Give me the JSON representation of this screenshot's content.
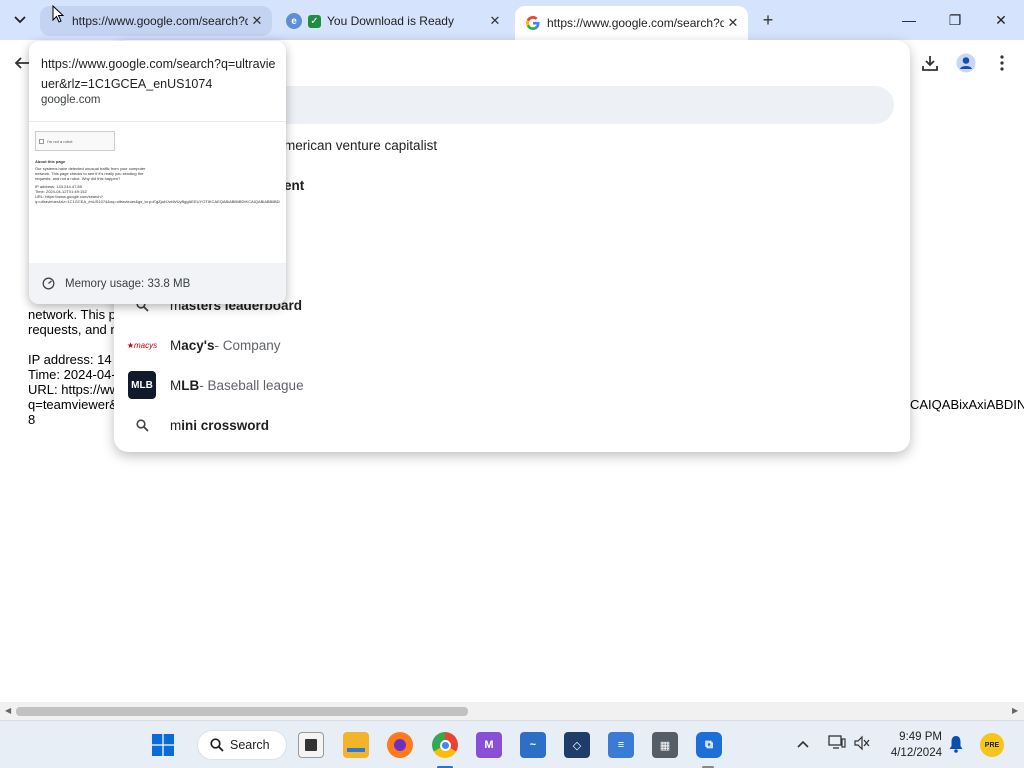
{
  "tabs": [
    {
      "title": "https://www.google.com/search?q=ultravieuer&rlz=1C1GCEA_enUS1074",
      "favicon": "google-g-icon",
      "active": false,
      "hovered": true
    },
    {
      "title": "You Download is Ready",
      "favicon": "checkmark-icon",
      "active": false
    },
    {
      "title": "https://www.google.com/search?q=teamviewer",
      "favicon": "google-g-icon",
      "active": true
    }
  ],
  "window_controls": {
    "minimize": "—",
    "maximize": "❐",
    "close": "✕"
  },
  "hovercard": {
    "url": "https://www.google.com/search?q=ultravieuer&rlz=1C1GCEA_enUS1074",
    "domain": "google.com",
    "memory": "Memory usage: 33.8 MB",
    "thumb_captcha": "I'm not a robot",
    "thumb_heading": "About this page",
    "thumb_lines": [
      "Our systems have detected unusual traffic from your computer",
      "network. This page checks to see if it's really you sending the",
      "requests, and not a robot. Why did this happen?",
      "IP address: 143.244.47.85",
      "Time: 2024-04-12T01:49:15Z",
      "URL: https://www.google.com/search?",
      "q=ultravieuer&rlz=1C1GCEA_enUS1074&oq=ultravieuer&gs_lcrp=EgZjaHJvbWUyBggAEEUYOTIKCAEQABiABBiiBDIKCAIQABiABBiiBDIKCAMQABiABBiiBNIBCDI2MTBqMGo3qAIAsAIA&sourceid=chrome&ie=UTF-8"
    ]
  },
  "omnibox": {
    "partial_suggestions": [
      {
        "text": "merican venture capitalist",
        "style": "muted"
      },
      {
        "text": "ent",
        "style": "bold"
      }
    ],
    "suggestions": [
      {
        "typed": "m",
        "rest": "asters leaderboard",
        "detail": "",
        "icon": "search-icon"
      },
      {
        "typed": "M",
        "rest": "acy's",
        "detail": " - Company",
        "icon": "macys-logo-icon"
      },
      {
        "typed": "M",
        "rest": "LB",
        "detail": " - Baseball league",
        "icon": "mlb-logo-icon"
      },
      {
        "typed": "m",
        "rest": "ini crossword",
        "detail": "",
        "icon": "search-icon"
      }
    ]
  },
  "page_text": {
    "line1": "network. This p",
    "line2": "requests, and n",
    "ip": "IP address: 14",
    "time": "Time: 2024-04-",
    "url": "URL: https://ww",
    "q": "q=teamviewer&",
    "tail": "8",
    "right_fragment": "CAIQABixAxiABDIN"
  },
  "taskbar": {
    "search_label": "Search",
    "time": "9:49 PM",
    "date": "4/12/2024",
    "pinned": [
      "windows-start-icon",
      "task-view-icon",
      "file-explorer-icon",
      "firefox-icon",
      "chrome-icon",
      "visual-studio-preview-icon",
      "photos-app-icon",
      "virtualbox-icon",
      "notepad-icon",
      "calculator-icon",
      "remote-desktop-icon"
    ]
  },
  "colors": {
    "tabstrip": "#d6e3fc",
    "active_tab": "#ffffff",
    "taskbar": "#e8eef6",
    "accent": "#1a73e8"
  }
}
